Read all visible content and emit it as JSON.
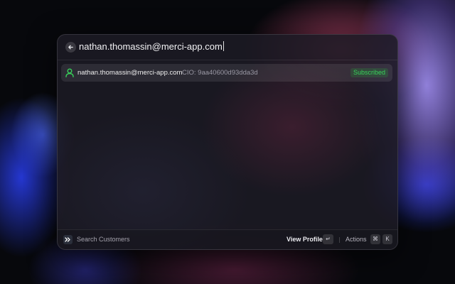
{
  "search": {
    "query": "nathan.thomassin@merci-app.com",
    "back_icon": "arrow-left-icon"
  },
  "results": [
    {
      "icon": "user-icon",
      "email": "nathan.thomassin@merci-app.com",
      "cio": "CIO: 9aa40600d93dda3d",
      "status": "Subscribed"
    }
  ],
  "footer": {
    "app_icon": "customerio-logo-icon",
    "title": "Search Customers",
    "primary_action": "View Profile",
    "primary_key": "↵",
    "actions_label": "Actions",
    "actions_keys": [
      "⌘",
      "K"
    ]
  },
  "colors": {
    "accent_green": "#38d15a",
    "window_bg": "#1c1a24",
    "text_primary": "#f2f2f4",
    "text_secondary": "#9a98a4"
  }
}
